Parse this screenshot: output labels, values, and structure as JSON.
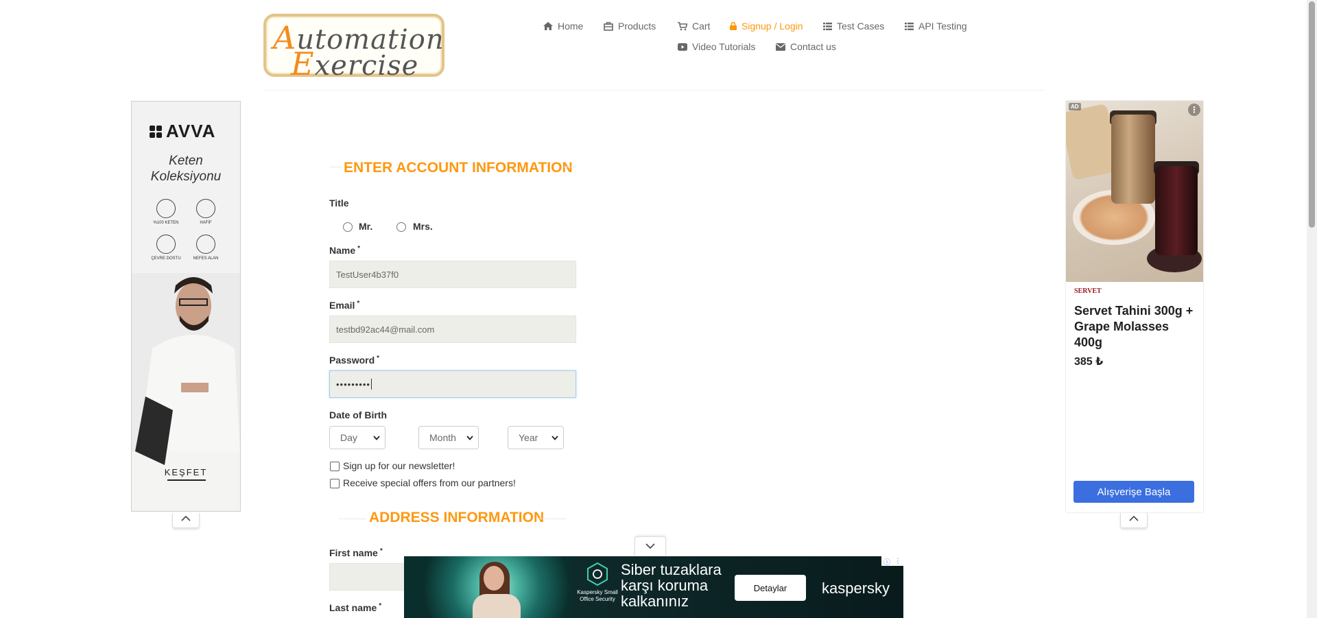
{
  "header": {
    "logo": {
      "line1_first": "A",
      "line1_rest": "utomation",
      "line2_first": "E",
      "line2_rest": "xercise"
    },
    "nav": [
      {
        "label": "Home",
        "icon": "home-icon"
      },
      {
        "label": "Products",
        "icon": "products-icon"
      },
      {
        "label": "Cart",
        "icon": "cart-icon"
      },
      {
        "label": "Signup / Login",
        "icon": "lock-icon",
        "active": true
      },
      {
        "label": "Test Cases",
        "icon": "list-icon"
      },
      {
        "label": "API Testing",
        "icon": "list-icon"
      },
      {
        "label": "Video Tutorials",
        "icon": "youtube-icon"
      },
      {
        "label": "Contact us",
        "icon": "envelope-icon"
      }
    ]
  },
  "form": {
    "title": "ENTER ACCOUNT INFORMATION",
    "title_label": "Title",
    "title_options": [
      "Mr.",
      "Mrs."
    ],
    "name": {
      "label": "Name",
      "required_mark": "*",
      "value": "TestUser4b37f0"
    },
    "email": {
      "label": "Email",
      "required_mark": "*",
      "value": "testbd92ac44@mail.com"
    },
    "password": {
      "label": "Password",
      "required_mark": "*",
      "value": "•••••••••"
    },
    "dob": {
      "label": "Date of Birth",
      "day": "Day",
      "month": "Month",
      "year": "Year"
    },
    "newsletter": "Sign up for our newsletter!",
    "offers": "Receive special offers from our partners!",
    "address_title": "ADDRESS INFORMATION",
    "first_name": {
      "label": "First name",
      "required_mark": "*",
      "value": ""
    },
    "last_name": {
      "label": "Last name",
      "required_mark": "*"
    }
  },
  "ad_left": {
    "brand": "AVVA",
    "collection_line1": "Keten",
    "collection_line2": "Koleksiyonu",
    "features": [
      "%100 KETEN",
      "HAFİF",
      "ÇEVRE DOSTU",
      "NEFES ALAN"
    ],
    "cta": "KEŞFET"
  },
  "ad_right": {
    "badge": "AD",
    "brand": "SERVET",
    "title": "Servet Tahini 300g + Grape Molasses 400g",
    "price": "385 ₺",
    "cta": "Alışverişe Başla"
  },
  "ad_bottom": {
    "brand_small": "Kaspersky Small Office Security",
    "headline": "Siber tuzaklara\nkarşı koruma\nkalkanınız",
    "cta": "Detaylar",
    "brand": "kaspersky"
  },
  "colors": {
    "accent": "#fe980f",
    "input_bg": "#eeeee9",
    "ad_button": "#3b6fe0"
  }
}
